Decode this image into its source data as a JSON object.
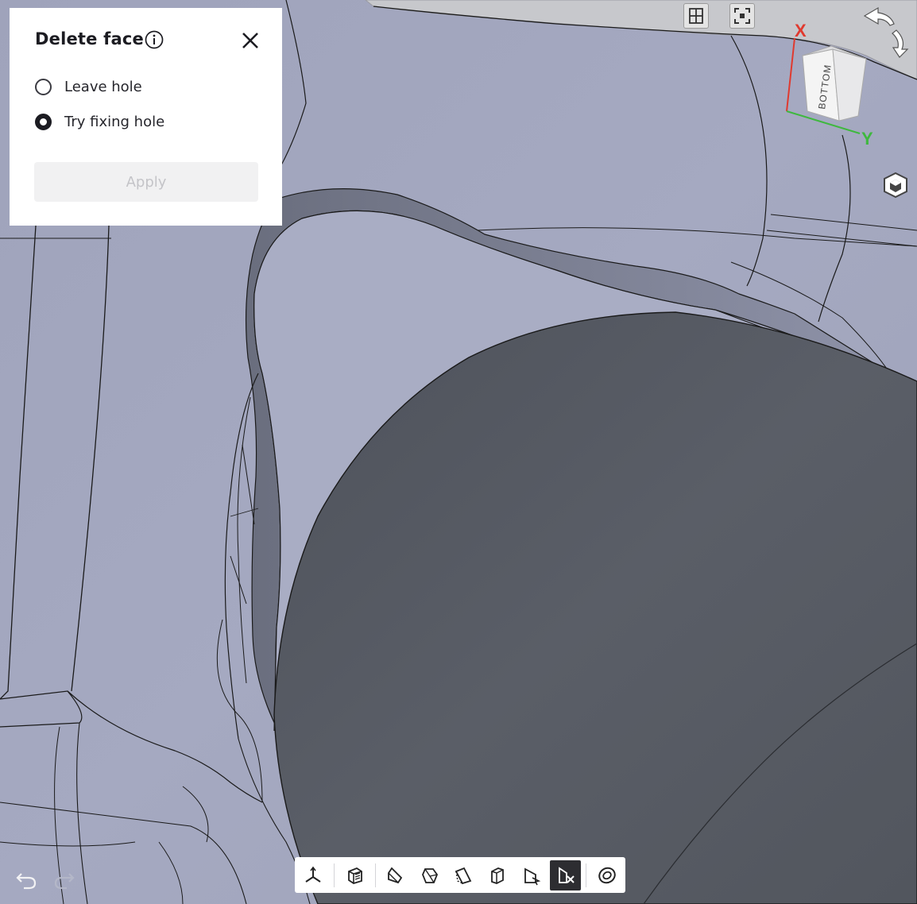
{
  "panel": {
    "title": "Delete face",
    "options": [
      {
        "label": "Leave hole",
        "selected": false
      },
      {
        "label": "Try fixing hole",
        "selected": true
      }
    ],
    "apply_label": "Apply"
  },
  "view_cube": {
    "face_label": "BOTTOM",
    "axis_x": "X",
    "axis_y": "Y"
  },
  "colors": {
    "axis_x": "#e03a2f",
    "axis_y": "#3fb83f",
    "model_face": "#a3a7bf",
    "dark_face": "#555962"
  },
  "icons": {
    "top_buttons": [
      "section-view-icon",
      "fit-view-icon"
    ],
    "toolbar": [
      "axes-view-icon",
      "shaded-view-icon",
      "front-view-icon",
      "side-view-icon",
      "top-view-icon",
      "iso-view-icon",
      "select-view-icon",
      "delete-face-icon",
      "surface-icon"
    ],
    "active_toolbar": "delete-face-icon"
  }
}
